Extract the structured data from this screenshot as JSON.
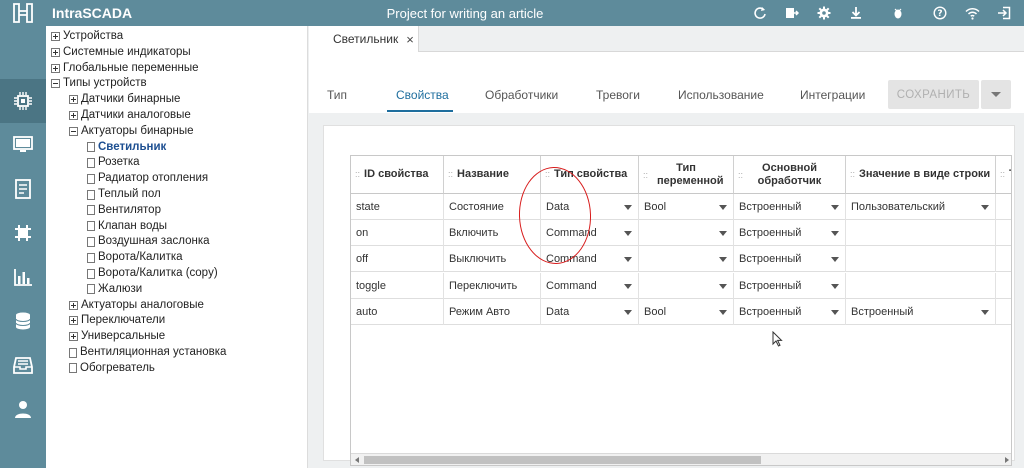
{
  "app": {
    "title": "IntraSCADA",
    "project_title": "Project for writing an article"
  },
  "top_icons": [
    "refresh-icon",
    "export-icon",
    "settings-gear-icon",
    "download-icon",
    "bug-icon",
    "help-icon",
    "wifi-icon",
    "logout-icon"
  ],
  "rail_icons": [
    "devices-chip-icon",
    "monitor-icon",
    "document-icon",
    "network-icon",
    "chart-icon",
    "database-icon",
    "archive-icon",
    "user-icon"
  ],
  "tree": {
    "items": [
      {
        "label": "Устройства",
        "type": "plus",
        "level": 0
      },
      {
        "label": "Системные индикаторы",
        "type": "plus",
        "level": 0
      },
      {
        "label": "Глобальные переменные",
        "type": "plus",
        "level": 0
      },
      {
        "label": "Типы устройств",
        "type": "minus",
        "level": 0
      },
      {
        "label": "Датчики бинарные",
        "type": "plus",
        "level": 1
      },
      {
        "label": "Датчики аналоговые",
        "type": "plus",
        "level": 1
      },
      {
        "label": "Актуаторы бинарные",
        "type": "minus",
        "level": 1
      },
      {
        "label": "Светильник",
        "type": "doc",
        "level": 2,
        "selected": true
      },
      {
        "label": "Розетка",
        "type": "doc",
        "level": 2
      },
      {
        "label": "Радиатор отопления",
        "type": "doc",
        "level": 2
      },
      {
        "label": "Теплый пол",
        "type": "doc",
        "level": 2
      },
      {
        "label": "Вентилятор",
        "type": "doc",
        "level": 2
      },
      {
        "label": "Клапан воды",
        "type": "doc",
        "level": 2
      },
      {
        "label": "Воздушная заслонка",
        "type": "doc",
        "level": 2
      },
      {
        "label": "Ворота/Калитка",
        "type": "doc",
        "level": 2
      },
      {
        "label": "Ворота/Калитка (copy)",
        "type": "doc",
        "level": 2
      },
      {
        "label": "Жалюзи",
        "type": "doc",
        "level": 2
      },
      {
        "label": "Актуаторы аналоговые",
        "type": "plus",
        "level": 1
      },
      {
        "label": "Переключатели",
        "type": "plus",
        "level": 1
      },
      {
        "label": "Универсальные",
        "type": "plus",
        "level": 1
      },
      {
        "label": "Вентиляционная установка",
        "type": "doc",
        "level": 1
      },
      {
        "label": "Обогреватель",
        "type": "doc",
        "level": 1
      }
    ]
  },
  "document_tab": {
    "label": "Светильник",
    "close": "×"
  },
  "subtabs": {
    "items": [
      "Тип",
      "Свойства",
      "Обработчики",
      "Тревоги",
      "Использование",
      "Интеграции"
    ],
    "active": "Свойства"
  },
  "save_button": {
    "label": "СОХРАНИТЬ",
    "enabled": false
  },
  "grid": {
    "columns": [
      {
        "label": "ID свойства",
        "grip": "::"
      },
      {
        "label": "Название",
        "grip": "::"
      },
      {
        "label": "Тип свойства",
        "grip": "::"
      },
      {
        "label": "Тип переменной",
        "grip": "::"
      },
      {
        "label": "Основной обработчик",
        "grip": "::"
      },
      {
        "label": "Значение в виде строки",
        "grip": "::"
      },
      {
        "label": "Т",
        "grip": "::"
      }
    ],
    "rows": [
      {
        "id": "state",
        "name": "Состояние",
        "prop_type": "Data",
        "var_type": "Bool",
        "handler": "Встроенный",
        "string_value": "Пользовательский"
      },
      {
        "id": "on",
        "name": "Включить",
        "prop_type": "Command",
        "var_type": "",
        "handler": "Встроенный",
        "string_value": ""
      },
      {
        "id": "off",
        "name": "Выключить",
        "prop_type": "Command",
        "var_type": "",
        "handler": "Встроенный",
        "string_value": ""
      },
      {
        "id": "toggle",
        "name": "Переключить",
        "prop_type": "Command",
        "var_type": "",
        "handler": "Встроенный",
        "string_value": ""
      },
      {
        "id": "auto",
        "name": "Режим Авто",
        "prop_type": "Data",
        "var_type": "Bool",
        "handler": "Встроенный",
        "string_value": "Встроенный"
      }
    ]
  },
  "colors": {
    "topbar": "#5e8b9b",
    "rail_active": "#4b7584",
    "accent": "#1e6e9e",
    "annotation_circle": "#d81e1e"
  }
}
